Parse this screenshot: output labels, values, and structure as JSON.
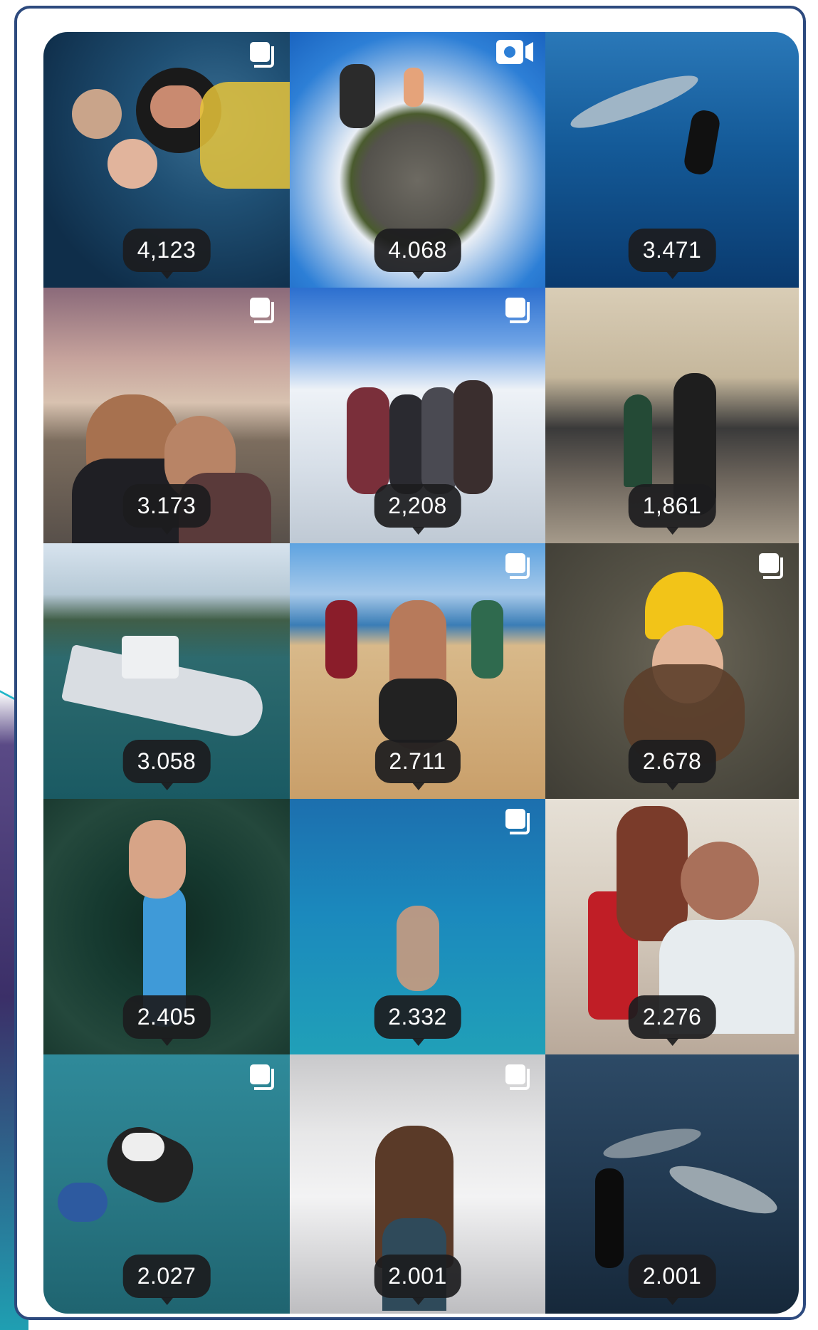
{
  "grid": {
    "posts": [
      {
        "views": "4,123",
        "type": "carousel"
      },
      {
        "views": "4.068",
        "type": "video"
      },
      {
        "views": "3.471",
        "type": "photo"
      },
      {
        "views": "3.173",
        "type": "carousel"
      },
      {
        "views": "2,208",
        "type": "carousel"
      },
      {
        "views": "1,861",
        "type": "photo"
      },
      {
        "views": "3.058",
        "type": "photo"
      },
      {
        "views": "2.711",
        "type": "carousel"
      },
      {
        "views": "2.678",
        "type": "carousel"
      },
      {
        "views": "2.405",
        "type": "photo"
      },
      {
        "views": "2.332",
        "type": "carousel"
      },
      {
        "views": "2.276",
        "type": "photo"
      },
      {
        "views": "2.027",
        "type": "carousel"
      },
      {
        "views": "2.001",
        "type": "carousel"
      },
      {
        "views": "2.001",
        "type": "photo"
      }
    ]
  },
  "colors": {
    "frame_border": "#2d4a7e",
    "badge_bg": "#1c1c1e",
    "badge_text": "#ffffff"
  },
  "icons": {
    "carousel": "carousel-icon",
    "video": "video-icon"
  }
}
